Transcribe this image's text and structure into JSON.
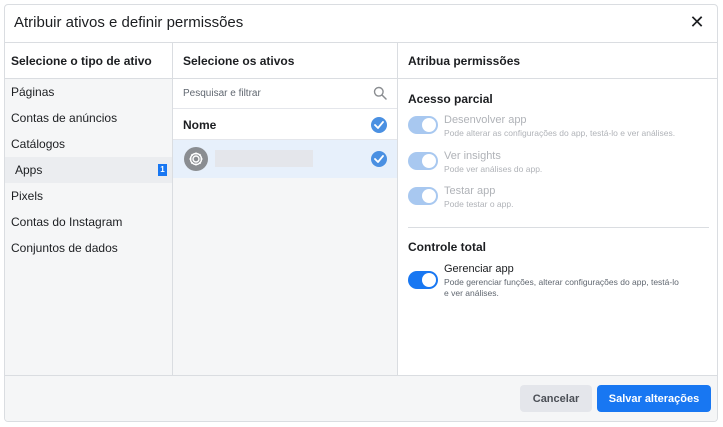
{
  "dialog": {
    "title": "Atribuir ativos e definir permissões",
    "close_icon": "close-icon"
  },
  "types": {
    "header": "Selecione o tipo de ativo",
    "items": [
      {
        "label": "Páginas"
      },
      {
        "label": "Contas de anúncios"
      },
      {
        "label": "Catálogos"
      },
      {
        "label": "Apps",
        "badge": "1",
        "selected": true
      },
      {
        "label": "Pixels"
      },
      {
        "label": "Contas do Instagram"
      },
      {
        "label": "Conjuntos de dados"
      }
    ]
  },
  "assets": {
    "header": "Selecione os ativos",
    "search_placeholder": "Pesquisar e filtrar",
    "search_icon": "search-icon",
    "name_column": "Nome",
    "select_all_checked": true,
    "rows": [
      {
        "icon": "app-gear-icon",
        "checked": true
      }
    ]
  },
  "permissions": {
    "header": "Atribua permissões",
    "partial": {
      "title": "Acesso parcial",
      "items": [
        {
          "label": "Desenvolver app",
          "desc": "Pode alterar as configurações do app, testá-lo e ver análises.",
          "on": true,
          "disabled": true
        },
        {
          "label": "Ver insights",
          "desc": "Pode ver análises do app.",
          "on": true,
          "disabled": true
        },
        {
          "label": "Testar app",
          "desc": "Pode testar o app.",
          "on": true,
          "disabled": true
        }
      ]
    },
    "full": {
      "title": "Controle total",
      "items": [
        {
          "label": "Gerenciar app",
          "desc_line1": "Pode gerenciar funções, alterar configurações do app, testá-lo",
          "desc_line2": "e ver análises.",
          "on": true,
          "disabled": false
        }
      ]
    }
  },
  "footer": {
    "cancel_label": "Cancelar",
    "save_label": "Salvar alterações"
  },
  "colors": {
    "accent": "#1877f2",
    "selected_row": "#e7f0fb",
    "toggle_disabled": "#a8c8f0"
  }
}
